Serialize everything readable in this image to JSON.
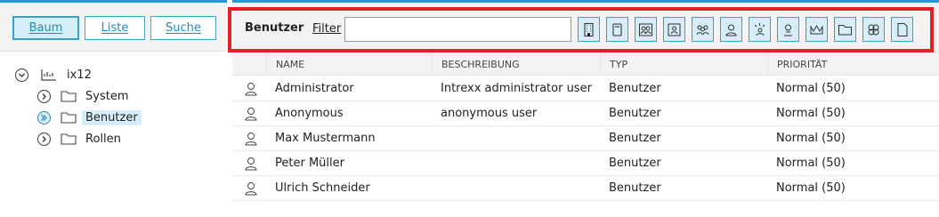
{
  "tabs": [
    {
      "label": "Baum",
      "active": true
    },
    {
      "label": "Liste",
      "active": false
    },
    {
      "label": "Suche",
      "active": false
    }
  ],
  "tree": {
    "root": {
      "label": "ix12",
      "icon": "portal-icon"
    },
    "children": [
      {
        "label": "System",
        "icon": "folder-icon",
        "selected": false
      },
      {
        "label": "Benutzer",
        "icon": "folder-icon",
        "selected": true
      },
      {
        "label": "Rollen",
        "icon": "folder-icon",
        "selected": false
      }
    ]
  },
  "toolbar": {
    "title": "Benutzer",
    "filter_label": "Filter",
    "filter_value": "",
    "icons": [
      "building-icon",
      "id-card-icon",
      "groups-icon",
      "badge-icon",
      "role-users-icon",
      "user-icon",
      "sparkle-user-icon",
      "location-user-icon",
      "crown-icon",
      "folder-icon",
      "clover-icon",
      "document-icon"
    ]
  },
  "grid": {
    "columns": [
      "NAME",
      "BESCHREIBUNG",
      "TYP",
      "PRIORITÄT"
    ],
    "rows": [
      {
        "name": "Administrator",
        "description": "Intrexx administrator user",
        "type": "Benutzer",
        "priority": "Normal (50)"
      },
      {
        "name": "Anonymous",
        "description": "anonymous user",
        "type": "Benutzer",
        "priority": "Normal (50)"
      },
      {
        "name": "Max Mustermann",
        "description": "",
        "type": "Benutzer",
        "priority": "Normal (50)"
      },
      {
        "name": "Peter Müller",
        "description": "",
        "type": "Benutzer",
        "priority": "Normal (50)"
      },
      {
        "name": "Ulrich Schneider",
        "description": "",
        "type": "Benutzer",
        "priority": "Normal (50)"
      }
    ]
  },
  "colors": {
    "accent": "#2a87b3",
    "highlight": "#d6eef8",
    "annotation": "#e3202a"
  }
}
